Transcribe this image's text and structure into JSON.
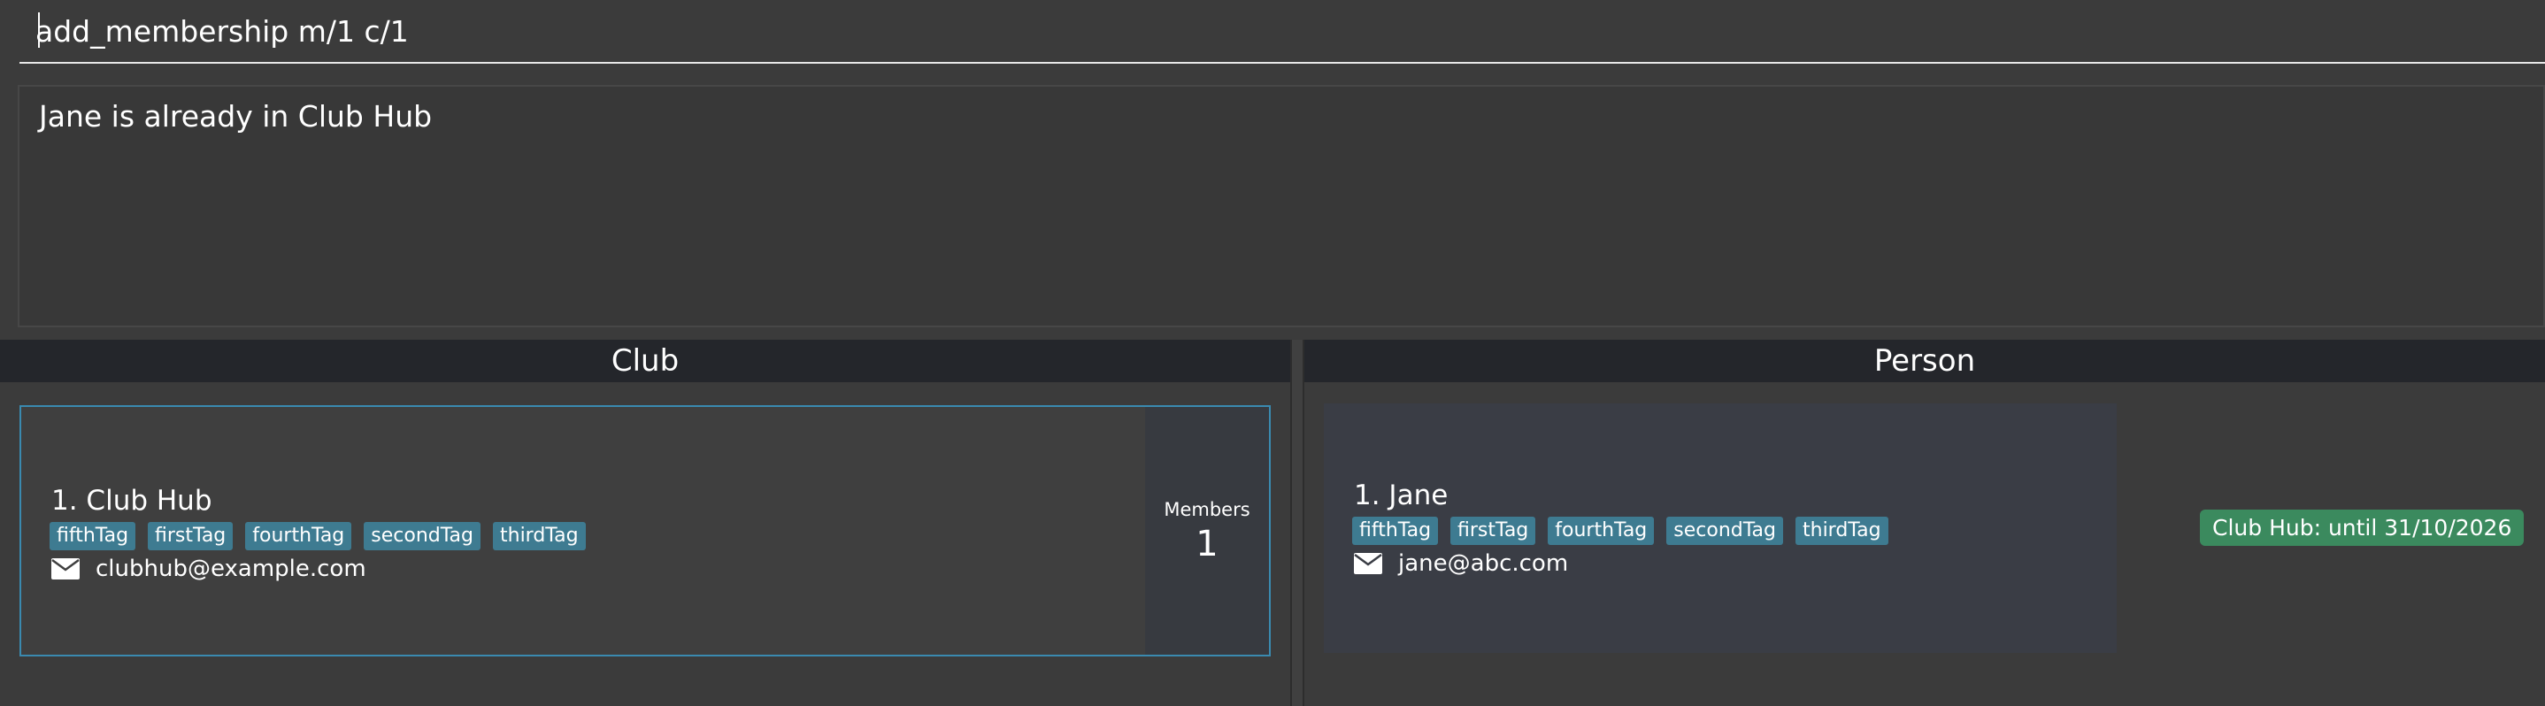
{
  "command_box": {
    "value": "add_membership m/1 c/1"
  },
  "result_box": {
    "message": "Jane is already in Club Hub"
  },
  "club_panel": {
    "title": "Club",
    "cards": [
      {
        "index_name": "1. Club Hub",
        "tags": [
          "fifthTag",
          "firstTag",
          "fourthTag",
          "secondTag",
          "thirdTag"
        ],
        "email": "clubhub@example.com",
        "members_label": "Members",
        "members_count": "1"
      }
    ]
  },
  "person_panel": {
    "title": "Person",
    "cards": [
      {
        "index_name": "1. Jane",
        "tags": [
          "fifthTag",
          "firstTag",
          "fourthTag",
          "secondTag",
          "thirdTag"
        ],
        "email": "jane@abc.com",
        "membership": "Club Hub: until 31/10/2026"
      }
    ]
  },
  "colors": {
    "background": "#3b3b3b",
    "header": "#24262b",
    "tag": "#3e7b91",
    "membership_badge": "#3b8a5e",
    "selected_border": "#3a8ab0"
  },
  "icons": {
    "email": "mail-icon"
  }
}
